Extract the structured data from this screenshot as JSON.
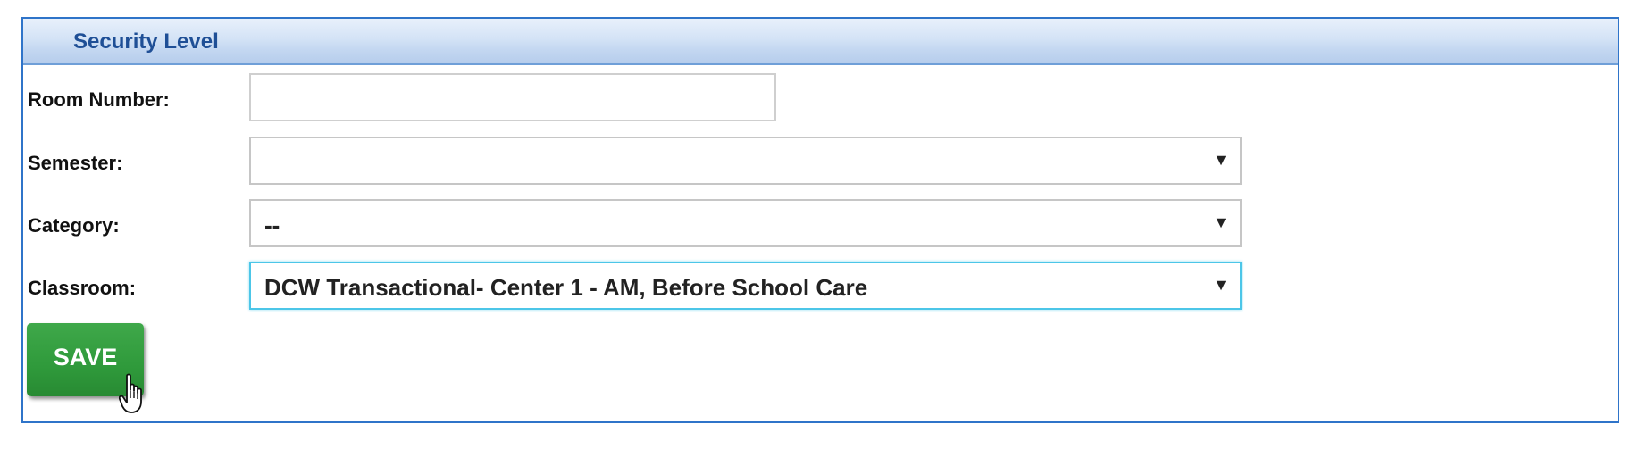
{
  "panel": {
    "title": "Security Level"
  },
  "form": {
    "room_number": {
      "label": "Room Number:",
      "value": ""
    },
    "semester": {
      "label": "Semester:",
      "value": ""
    },
    "category": {
      "label": "Category:",
      "value": "--"
    },
    "classroom": {
      "label": "Classroom:",
      "value": "DCW Transactional- Center 1 - AM, Before School Care"
    },
    "save_label": "SAVE"
  },
  "icons": {
    "dropdown_arrow": "▼",
    "cursor": "hand-pointer-icon"
  },
  "colors": {
    "header_text": "#1f4f96",
    "panel_border": "#2f74c9",
    "save_button": "#2f9a3b",
    "focus_border": "#4cc6e8"
  }
}
